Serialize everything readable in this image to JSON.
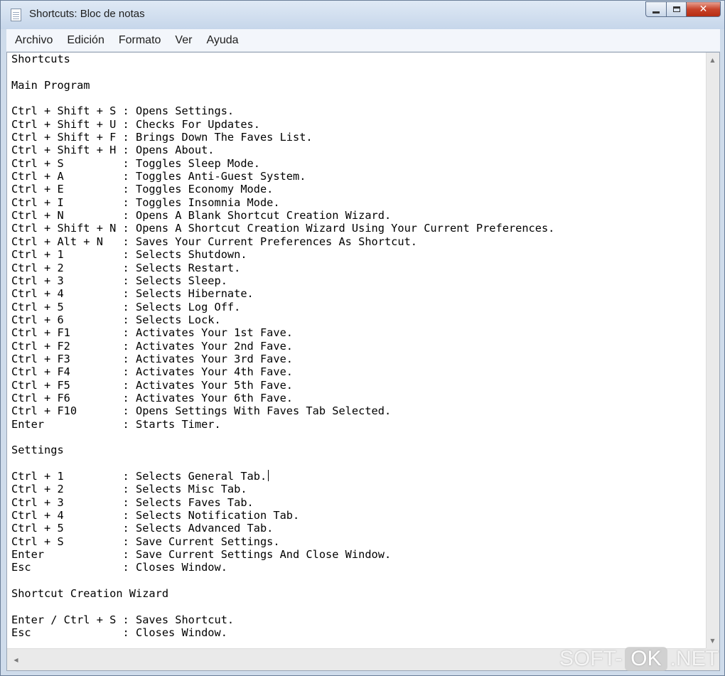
{
  "window": {
    "title": "Shortcuts: Bloc de notas",
    "close_glyph": "✕"
  },
  "menubar": {
    "items": [
      "Archivo",
      "Edición",
      "Formato",
      "Ver",
      "Ayuda"
    ]
  },
  "document": {
    "lines": [
      "Shortcuts",
      "",
      "Main Program",
      "",
      "Ctrl + Shift + S : Opens Settings.",
      "Ctrl + Shift + U : Checks For Updates.",
      "Ctrl + Shift + F : Brings Down The Faves List.",
      "Ctrl + Shift + H : Opens About.",
      "Ctrl + S         : Toggles Sleep Mode.",
      "Ctrl + A         : Toggles Anti-Guest System.",
      "Ctrl + E         : Toggles Economy Mode.",
      "Ctrl + I         : Toggles Insomnia Mode.",
      "Ctrl + N         : Opens A Blank Shortcut Creation Wizard.",
      "Ctrl + Shift + N : Opens A Shortcut Creation Wizard Using Your Current Preferences.",
      "Ctrl + Alt + N   : Saves Your Current Preferences As Shortcut.",
      "Ctrl + 1         : Selects Shutdown.",
      "Ctrl + 2         : Selects Restart.",
      "Ctrl + 3         : Selects Sleep.",
      "Ctrl + 4         : Selects Hibernate.",
      "Ctrl + 5         : Selects Log Off.",
      "Ctrl + 6         : Selects Lock.",
      "Ctrl + F1        : Activates Your 1st Fave.",
      "Ctrl + F2        : Activates Your 2nd Fave.",
      "Ctrl + F3        : Activates Your 3rd Fave.",
      "Ctrl + F4        : Activates Your 4th Fave.",
      "Ctrl + F5        : Activates Your 5th Fave.",
      "Ctrl + F6        : Activates Your 6th Fave.",
      "Ctrl + F10       : Opens Settings With Faves Tab Selected.",
      "Enter            : Starts Timer.",
      "",
      "Settings",
      "",
      "Ctrl + 1         : Selects General Tab.",
      "Ctrl + 2         : Selects Misc Tab.",
      "Ctrl + 3         : Selects Faves Tab.",
      "Ctrl + 4         : Selects Notification Tab.",
      "Ctrl + 5         : Selects Advanced Tab.",
      "Ctrl + S         : Save Current Settings.",
      "Enter            : Save Current Settings And Close Window.",
      "Esc              : Closes Window.",
      "",
      "Shortcut Creation Wizard",
      "",
      "Enter / Ctrl + S : Saves Shortcut.",
      "Esc              : Closes Window."
    ]
  },
  "watermark": {
    "left": "SOFT-",
    "middle": "OK",
    "right": ".NET"
  }
}
